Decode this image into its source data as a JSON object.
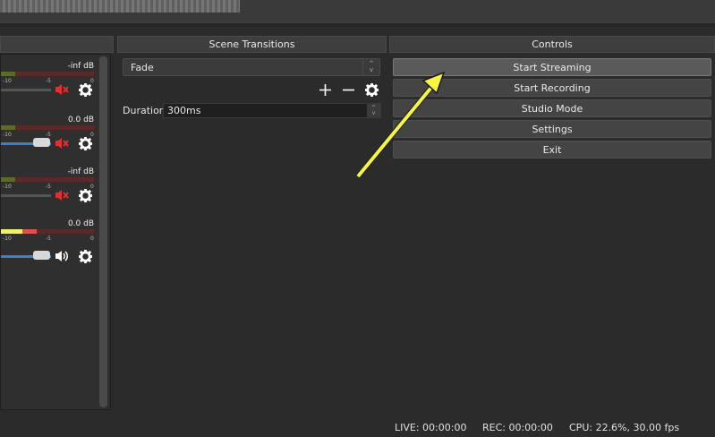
{
  "preview": {},
  "headers": {
    "scene_transitions": "Scene Transitions",
    "controls": "Controls"
  },
  "mixer": {
    "channels": [
      {
        "db": "-inf dB",
        "ticks": [
          "-10",
          "-5",
          "0"
        ],
        "muted": true
      },
      {
        "db": "0.0 dB",
        "ticks": [
          "-10",
          "-5",
          "0"
        ],
        "muted": true
      },
      {
        "db": "-inf dB",
        "ticks": [
          "-10",
          "-5",
          "0"
        ],
        "muted": true
      },
      {
        "db": "0.0 dB",
        "ticks": [
          "-10",
          "-5",
          "0"
        ],
        "muted": false
      }
    ]
  },
  "transitions": {
    "selected": "Fade",
    "duration_label": "Duration",
    "duration_value": "300ms"
  },
  "controls": {
    "start_streaming": "Start Streaming",
    "start_recording": "Start Recording",
    "studio_mode": "Studio Mode",
    "settings": "Settings",
    "exit": "Exit"
  },
  "status": {
    "live": "LIVE: 00:00:00",
    "rec": "REC: 00:00:00",
    "cpu": "CPU: 22.6%, 30.00 fps"
  },
  "colors": {
    "accent_arrow": "#f5f542",
    "mute_red": "#e03030",
    "volume_blue": "#3b7fd4"
  },
  "icons": [
    "add-icon",
    "remove-icon",
    "gear-icon",
    "speaker-muted-icon",
    "speaker-icon"
  ]
}
